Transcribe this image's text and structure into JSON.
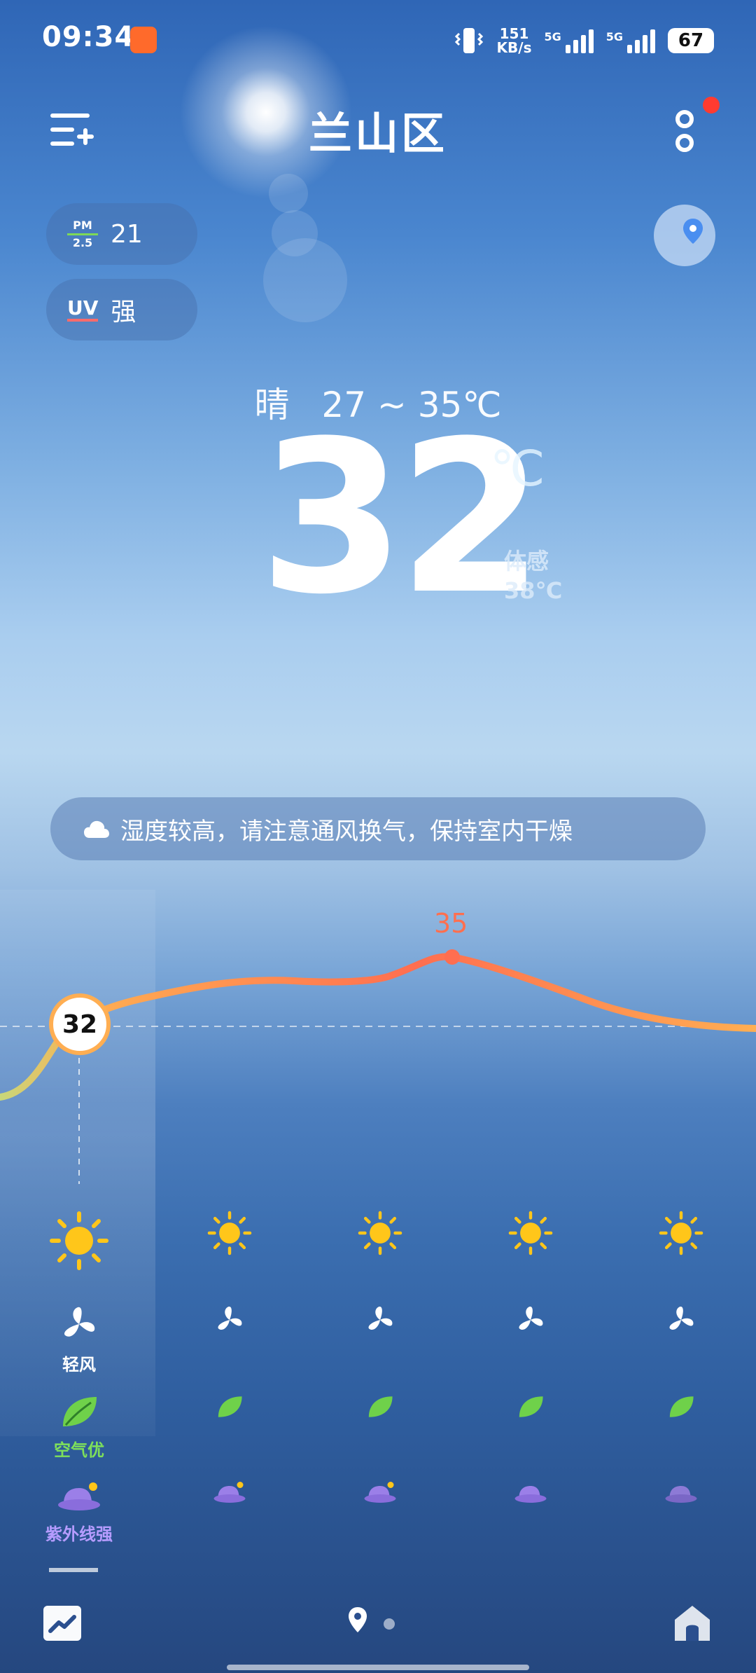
{
  "status_bar": {
    "time": "09:34",
    "net_speed_value": "151",
    "net_speed_unit": "KB/s",
    "sim1_label": "5G",
    "sim2_label": "5G",
    "battery": "67"
  },
  "header": {
    "title": "兰山区",
    "menu_icon": "add-city-menu-icon",
    "more_icon": "more-icon"
  },
  "indices": {
    "pm_top": "PM",
    "pm_bottom": "2.5",
    "pm_value": "21",
    "uv_label": "UV",
    "uv_value": "强"
  },
  "current": {
    "condition": "晴",
    "range": "27 ~ 35℃",
    "temp": "32",
    "unit": "℃",
    "feels_label": "体感",
    "feels_value": "38℃"
  },
  "alert": {
    "icon": "cloud-icon",
    "text": "湿度较高，请注意通风换气，保持室内干燥"
  },
  "hourly": {
    "current_temp": "32",
    "peak_temp": "35",
    "curve_colors": {
      "cool": "#c8d77a",
      "warm": "#ff9a5a",
      "hot": "#ff6e50"
    },
    "wind_label": "轻风",
    "air_label": "空气优",
    "uv_label": "紫外线强",
    "columns": [
      {
        "weather": "sun-icon",
        "wind": "fan-icon",
        "air": "leaf-icon",
        "uv": "hat-sun-icon"
      },
      {
        "weather": "sun-icon",
        "wind": "fan-icon",
        "air": "leaf-icon",
        "uv": "hat-sun-icon"
      },
      {
        "weather": "sun-icon",
        "wind": "fan-icon",
        "air": "leaf-icon",
        "uv": "hat-sun-icon"
      },
      {
        "weather": "sun-icon",
        "wind": "fan-icon",
        "air": "leaf-icon",
        "uv": "hat-icon"
      },
      {
        "weather": "sun-icon",
        "wind": "fan-icon",
        "air": "leaf-icon",
        "uv": "hat-icon"
      }
    ]
  },
  "bottom_nav": {
    "trend_icon": "trend-chart-icon",
    "location_icon": "location-pin-icon",
    "home_icon": "home-icon"
  }
}
